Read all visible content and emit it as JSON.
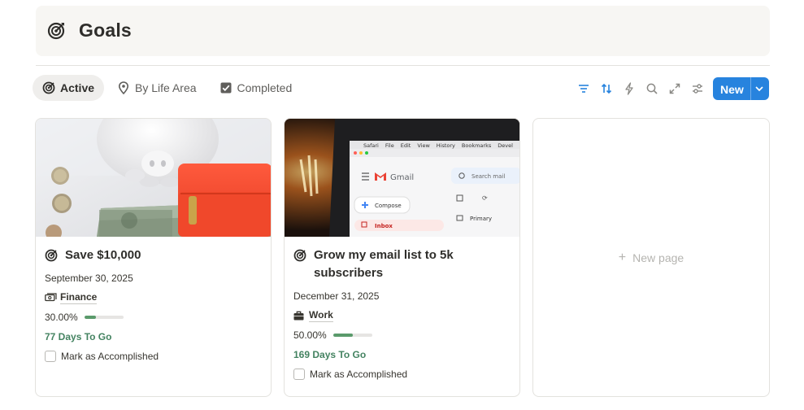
{
  "header": {
    "title": "Goals",
    "icon": "target-icon"
  },
  "tabs": [
    {
      "label": "Active",
      "icon": "target-icon",
      "active": true
    },
    {
      "label": "By Life Area",
      "icon": "map-pin-icon",
      "active": false
    },
    {
      "label": "Completed",
      "icon": "checkbox-icon",
      "active": false
    }
  ],
  "toolbar": {
    "icons": [
      "filter-icon",
      "sort-icon",
      "lightning-icon",
      "search-icon",
      "expand-icon",
      "settings-icon"
    ],
    "new_label": "New",
    "accent_color": "#2783de"
  },
  "cards": [
    {
      "title": "Save $10,000",
      "date": "September 30, 2025",
      "area": "Finance",
      "area_icon": "money-icon",
      "progress_label": "30.00%",
      "progress": 0.3,
      "days_to_go": "77 Days To Go",
      "checkbox_label": "Mark as Accomplished",
      "cover": "piggy-bank-photo"
    },
    {
      "title": "Grow my email list to 5k subscribers",
      "date": "December 31, 2025",
      "area": "Work",
      "area_icon": "briefcase-icon",
      "progress_label": "50.00%",
      "progress": 0.5,
      "days_to_go": "169 Days To Go",
      "checkbox_label": "Mark as Accomplished",
      "cover": "gmail-laptop-photo",
      "cover_text": {
        "menu": [
          "Safari",
          "File",
          "Edit",
          "View",
          "History",
          "Bookmarks",
          "Devel"
        ],
        "app": "Gmail",
        "search": "Search mail",
        "compose": "Compose",
        "inbox": "Inbox",
        "primary": "Primary"
      }
    }
  ],
  "new_page": {
    "label": "New page"
  },
  "colors": {
    "progress_fill": "#5a9a6b",
    "days_text": "#448361",
    "header_bg": "#f7f6f3"
  }
}
